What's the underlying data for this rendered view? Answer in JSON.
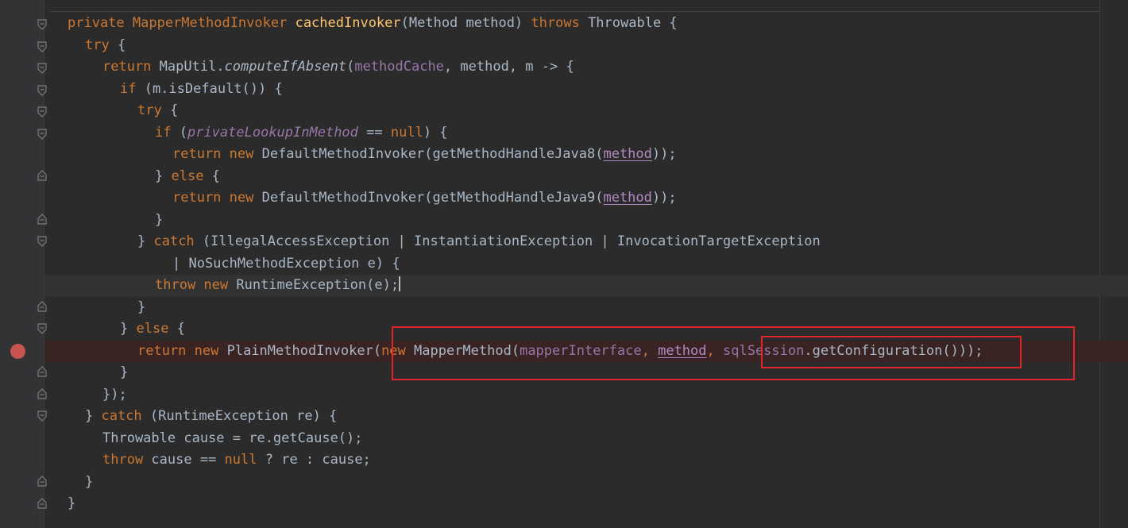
{
  "editor": {
    "language": "Java",
    "breakpoint_line": 16,
    "current_line": 13,
    "lines": [
      [
        "private MapperMethodInvoker ",
        "cachedInvoker",
        "(Method method) ",
        "throws ",
        "Throwable {"
      ],
      [
        "try ",
        "{"
      ],
      [
        "return ",
        "MapUtil.",
        "computeIfAbsent",
        "(",
        "methodCache",
        ", method, m -> {"
      ],
      [
        "if ",
        "(m.isDefault()) {"
      ],
      [
        "try ",
        "{"
      ],
      [
        "if ",
        "(",
        "privateLookupInMethod",
        " == ",
        "null",
        ") {"
      ],
      [
        "return new ",
        "DefaultMethodInvoker(getMethodHandleJava8(",
        "method",
        "));"
      ],
      [
        "} ",
        "else ",
        "{"
      ],
      [
        "return new ",
        "DefaultMethodInvoker(getMethodHandleJava9(",
        "method",
        "));"
      ],
      [
        "}"
      ],
      [
        "} ",
        "catch ",
        "(IllegalAccessException | InstantiationException | InvocationTargetException"
      ],
      [
        "| NoSuchMethodException e) {"
      ],
      [
        "throw new ",
        "RuntimeException(e);"
      ],
      [
        "}"
      ],
      [
        "} ",
        "else ",
        "{"
      ],
      [
        "return new ",
        "PlainMethodInvoker(",
        "new ",
        "MapperMethod(",
        "mapperInterface",
        ", ",
        "method",
        ", ",
        "sqlSession",
        ".getConfiguration()));"
      ],
      [
        "}"
      ],
      [
        "});"
      ],
      [
        "} ",
        "catch ",
        "(RuntimeException re) {"
      ],
      [
        "Throwable cause = re.getCause();"
      ],
      [
        "throw ",
        "cause == ",
        "null ",
        "? re : cause;"
      ],
      [
        "}"
      ],
      [
        "}"
      ]
    ]
  },
  "colors": {
    "background": "#2b2b2b",
    "keyword": "#cc7832",
    "method_decl": "#ffc66d",
    "field": "#9876aa",
    "plain": "#a9b7c6",
    "annotation_box": "#e0242a",
    "breakpoint": "#c75450"
  }
}
